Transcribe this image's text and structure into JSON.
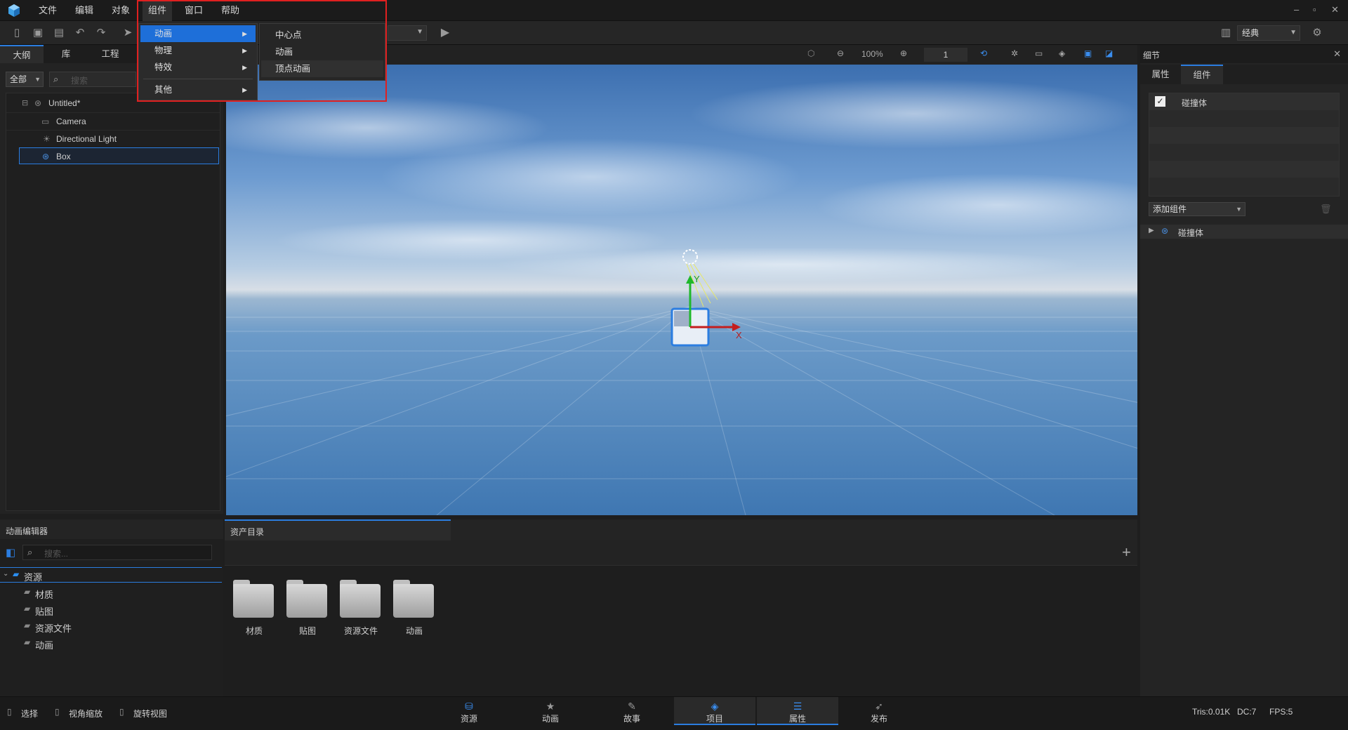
{
  "menubar": {
    "items": [
      "文件",
      "编辑",
      "对象",
      "组件",
      "窗口",
      "帮助"
    ],
    "window_controls": [
      "–",
      "▫",
      "✕"
    ]
  },
  "toolbar": {
    "layout_label": "经典"
  },
  "outline": {
    "tabs": [
      "大纲",
      "库",
      "工程"
    ],
    "filter": "全部",
    "search_placeholder": "搜索",
    "tree": [
      {
        "label": "Untitled*",
        "level": 0
      },
      {
        "label": "Camera",
        "level": 1
      },
      {
        "label": "Directional Light",
        "level": 1
      },
      {
        "label": "Box",
        "level": 1,
        "selected": true
      }
    ]
  },
  "component_menu": {
    "items": [
      "动画",
      "物理",
      "特效",
      "其他"
    ],
    "submenu": [
      "中心点",
      "动画",
      "顶点动画"
    ]
  },
  "scene_toolbar": {
    "zoom": "100%",
    "frame": "1"
  },
  "viewport": {
    "axis_y": "Y",
    "axis_x": "X"
  },
  "details": {
    "title": "细节",
    "tabs": [
      "属性",
      "组件"
    ],
    "component_list": [
      "碰撞体"
    ],
    "add_component": "添加组件",
    "collapsed_item": "碰撞体"
  },
  "anim_editor": {
    "title": "动画编辑器",
    "search_placeholder": "搜索...",
    "tree_root": "资源",
    "tree_items": [
      "材质",
      "贴图",
      "资源文件",
      "动画"
    ]
  },
  "assets": {
    "tab": "资产目录",
    "folders": [
      "材质",
      "贴图",
      "资源文件",
      "动画"
    ]
  },
  "statusbar": {
    "tools": [
      "选择",
      "视角缩放",
      "旋转视图"
    ],
    "tabs": [
      "资源",
      "动画",
      "故事",
      "项目",
      "属性",
      "发布"
    ],
    "stats": [
      "Tris:0.01K",
      "DC:7",
      "FPS:5"
    ]
  },
  "colors": {
    "accent": "#2b7de0",
    "highlight_box": "#e02020",
    "menu_selected": "#1e6fd9"
  }
}
